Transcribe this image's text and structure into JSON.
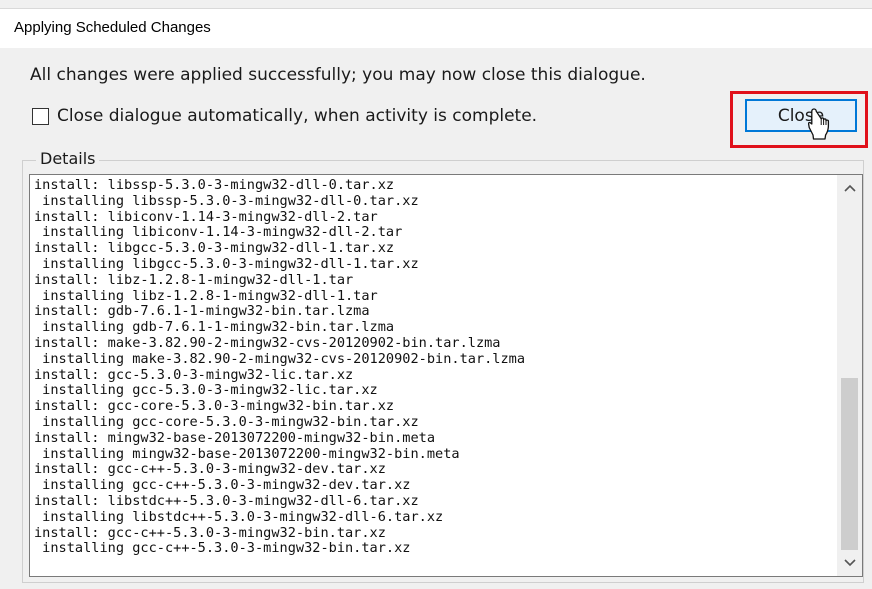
{
  "window": {
    "title": "Applying Scheduled Changes"
  },
  "message": "All changes were applied successfully; you may now close this dialogue.",
  "auto_close": {
    "label": "Close dialogue automatically, when activity is complete.",
    "checked": false
  },
  "close_button": {
    "label": "Close"
  },
  "details": {
    "label": "Details",
    "lines": [
      "install: libssp-5.3.0-3-mingw32-dll-0.tar.xz",
      " installing libssp-5.3.0-3-mingw32-dll-0.tar.xz",
      "install: libiconv-1.14-3-mingw32-dll-2.tar",
      " installing libiconv-1.14-3-mingw32-dll-2.tar",
      "install: libgcc-5.3.0-3-mingw32-dll-1.tar.xz",
      " installing libgcc-5.3.0-3-mingw32-dll-1.tar.xz",
      "install: libz-1.2.8-1-mingw32-dll-1.tar",
      " installing libz-1.2.8-1-mingw32-dll-1.tar",
      "install: gdb-7.6.1-1-mingw32-bin.tar.lzma",
      " installing gdb-7.6.1-1-mingw32-bin.tar.lzma",
      "install: make-3.82.90-2-mingw32-cvs-20120902-bin.tar.lzma",
      " installing make-3.82.90-2-mingw32-cvs-20120902-bin.tar.lzma",
      "install: gcc-5.3.0-3-mingw32-lic.tar.xz",
      " installing gcc-5.3.0-3-mingw32-lic.tar.xz",
      "install: gcc-core-5.3.0-3-mingw32-bin.tar.xz",
      " installing gcc-core-5.3.0-3-mingw32-bin.tar.xz",
      "install: mingw32-base-2013072200-mingw32-bin.meta",
      " installing mingw32-base-2013072200-mingw32-bin.meta",
      "install: gcc-c++-5.3.0-3-mingw32-dev.tar.xz",
      " installing gcc-c++-5.3.0-3-mingw32-dev.tar.xz",
      "install: libstdc++-5.3.0-3-mingw32-dll-6.tar.xz",
      " installing libstdc++-5.3.0-3-mingw32-dll-6.tar.xz",
      "install: gcc-c++-5.3.0-3-mingw32-bin.tar.xz",
      " installing gcc-c++-5.3.0-3-mingw32-bin.tar.xz"
    ]
  },
  "scrollbar": {
    "up_icon": "chevron-up-icon",
    "down_icon": "chevron-down-icon"
  },
  "colors": {
    "highlight": "#e0101a",
    "button_border": "#0078d7",
    "button_fill": "#e5f1fb"
  }
}
